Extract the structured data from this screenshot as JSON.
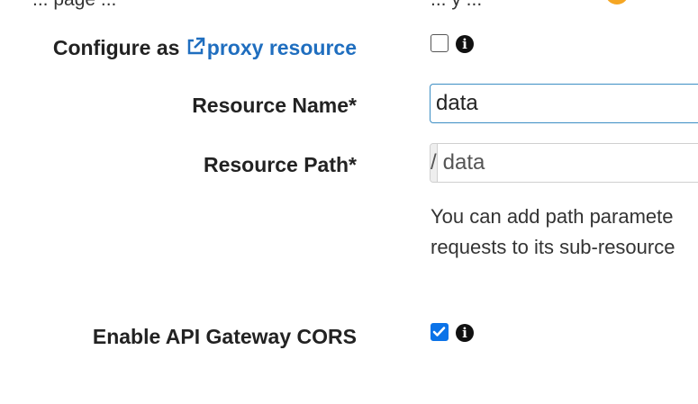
{
  "top_partial": {
    "left_text": "... page ...",
    "right_text": "... y ..."
  },
  "proxy": {
    "label_prefix": "Configure as ",
    "link_text": "proxy resource",
    "checked": false
  },
  "resource_name": {
    "label": "Resource Name*",
    "value": "data"
  },
  "resource_path": {
    "label": "Resource Path*",
    "prefix": "/",
    "value": "data",
    "help_line1": "You can add path paramete",
    "help_line2": "requests to its sub-resource"
  },
  "cors": {
    "label": "Enable API Gateway CORS",
    "checked": true
  },
  "colors": {
    "link": "#1f6ebf",
    "checkbox_checked": "#0b73e8",
    "input_focus_border": "#3c8ec4",
    "badge": "#f5a623"
  },
  "icons": {
    "external_link": "external-link-icon",
    "info": "info-icon",
    "check": "checkmark-icon"
  }
}
